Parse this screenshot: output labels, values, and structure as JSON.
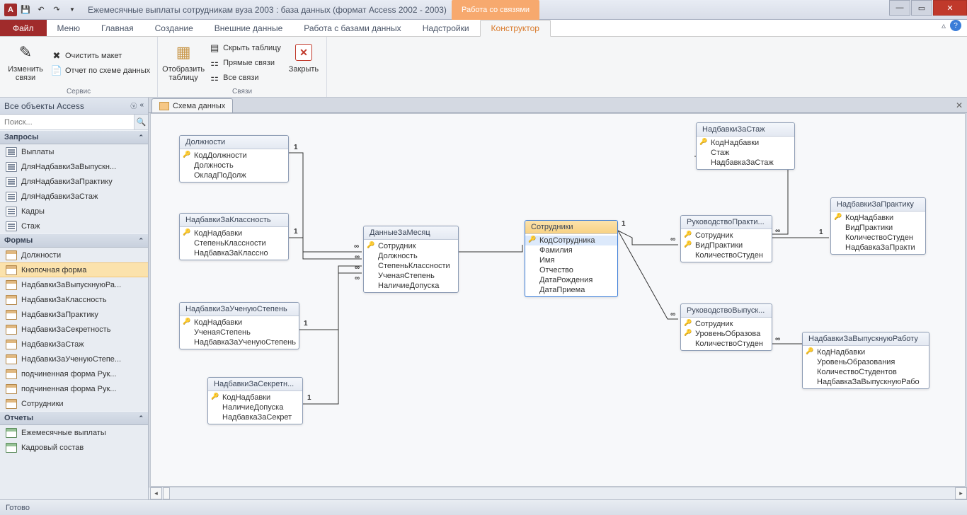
{
  "titlebar": {
    "app_label": "A",
    "title": "Ежемесячные выплаты сотрудникам вуза 2003 : база данных (формат Access 2002 - 2003)",
    "context_tab": "Работа со связями"
  },
  "ribbon_tabs": {
    "file": "Файл",
    "tabs": [
      "Меню",
      "Главная",
      "Создание",
      "Внешние данные",
      "Работа с базами данных",
      "Надстройки"
    ],
    "active": "Конструктор"
  },
  "ribbon": {
    "group1": {
      "label": "Сервис",
      "edit_rel": "Изменить связи",
      "clear_layout": "Очистить макет",
      "rel_report": "Отчет по схеме данных"
    },
    "group2": {
      "label": "Связи",
      "show_table": "Отобразить таблицу",
      "hide_table": "Скрыть таблицу",
      "direct_rel": "Прямые связи",
      "all_rel": "Все связи",
      "close": "Закрыть"
    }
  },
  "nav": {
    "header": "Все объекты Access",
    "search_placeholder": "Поиск...",
    "groups": {
      "queries": {
        "label": "Запросы",
        "items": [
          "Выплаты",
          "ДляНадбавкиЗаВыпускн...",
          "ДляНадбавкиЗаПрактику",
          "ДляНадбавкиЗаСтаж",
          "Кадры",
          "Стаж"
        ]
      },
      "forms": {
        "label": "Формы",
        "items": [
          "Должности",
          "Кнопочная форма",
          "НадбавкиЗаВыпускнуюРа...",
          "НадбавкиЗаКлассность",
          "НадбавкиЗаПрактику",
          "НадбавкиЗаСекретность",
          "НадбавкиЗаСтаж",
          "НадбавкиЗаУченуюСтепе...",
          "подчиненная форма Рук...",
          "подчиненная форма Рук...",
          "Сотрудники"
        ],
        "selected": 1
      },
      "reports": {
        "label": "Отчеты",
        "items": [
          "Ежемесячные выплаты",
          "Кадровый состав"
        ]
      }
    }
  },
  "tab": {
    "title": "Схема данных"
  },
  "tables": {
    "t1": {
      "title": "Должности",
      "fields": [
        "КодДолжности",
        "Должность",
        "ОкладПоДолж"
      ],
      "pk": [
        0
      ]
    },
    "t2": {
      "title": "НадбавкиЗаКлассность",
      "fields": [
        "КодНадбавки",
        "СтепеньКлассности",
        "НадбавкаЗаКлассно"
      ],
      "pk": [
        0
      ]
    },
    "t3": {
      "title": "НадбавкиЗаУченуюСтепень",
      "fields": [
        "КодНадбавки",
        "УченаяСтепень",
        "НадбавкаЗаУченуюСтепень"
      ],
      "pk": [
        0
      ]
    },
    "t4": {
      "title": "НадбавкиЗаСекретн...",
      "fields": [
        "КодНадбавки",
        "НаличиеДопуска",
        "НадбавкаЗаСекрет"
      ],
      "pk": [
        0
      ]
    },
    "t5": {
      "title": "ДанныеЗаМесяц",
      "fields": [
        "Сотрудник",
        "Должность",
        "СтепеньКлассности",
        "УченаяСтепень",
        "НаличиеДопуска"
      ],
      "pk": [
        0
      ]
    },
    "t6": {
      "title": "Сотрудники",
      "fields": [
        "КодСотрудника",
        "Фамилия",
        "Имя",
        "Отчество",
        "ДатаРождения",
        "ДатаПриема"
      ],
      "pk": [
        0
      ],
      "selected_field": 0
    },
    "t7": {
      "title": "НадбавкиЗаСтаж",
      "fields": [
        "КодНадбавки",
        "Стаж",
        "НадбавкаЗаСтаж"
      ],
      "pk": [
        0
      ]
    },
    "t8": {
      "title": "РуководствоПракти...",
      "fields": [
        "Сотрудник",
        "ВидПрактики",
        "КоличествоСтуден"
      ],
      "pk": [
        0,
        1
      ]
    },
    "t9": {
      "title": "РуководствоВыпуск...",
      "fields": [
        "Сотрудник",
        "УровеньОбразова",
        "КоличествоСтуден"
      ],
      "pk": [
        0,
        1
      ]
    },
    "t10": {
      "title": "НадбавкиЗаПрактику",
      "fields": [
        "КодНадбавки",
        "ВидПрактики",
        "КоличествоСтуден",
        "НадбавкаЗаПракти"
      ],
      "pk": [
        0
      ]
    },
    "t11": {
      "title": "НадбавкиЗаВыпускнуюРаботу",
      "fields": [
        "КодНадбавки",
        "УровеньОбразования",
        "КоличествоСтудентов",
        "НадбавкаЗаВыпускнуюРабо"
      ],
      "pk": [
        0
      ]
    }
  },
  "status": {
    "ready": "Готово"
  }
}
